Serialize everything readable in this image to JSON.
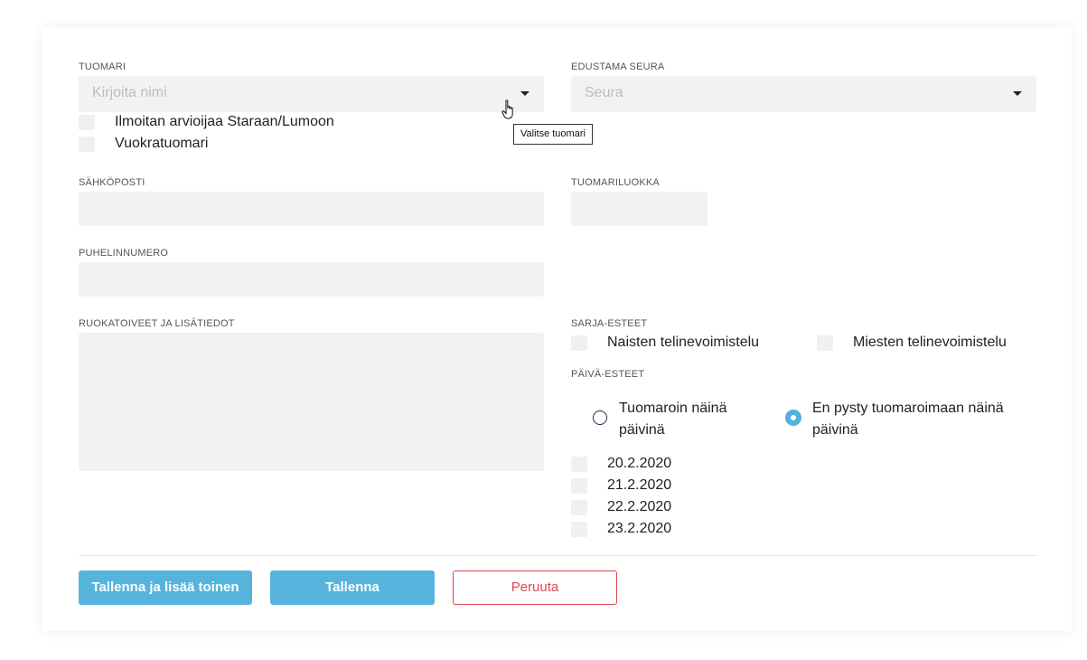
{
  "tuomari": {
    "label": "TUOMARI",
    "placeholder": "Kirjoita nimi",
    "tooltip": "Valitse tuomari",
    "checkboxes": [
      {
        "label": "Ilmoitan arvioijaa Staraan/Lumoon",
        "checked": false
      },
      {
        "label": "Vuokratuomari",
        "checked": false
      }
    ]
  },
  "seura": {
    "label": "EDUSTAMA SEURA",
    "placeholder": "Seura"
  },
  "sahkoposti": {
    "label": "SÄHKÖPOSTI",
    "value": ""
  },
  "tuomariluokka": {
    "label": "TUOMARILUOKKA",
    "value": ""
  },
  "puhelinnumero": {
    "label": "PUHELINNUMERO",
    "value": ""
  },
  "ruokatoiveet": {
    "label": "RUOKATOIVEET JA LISÄTIEDOT",
    "value": ""
  },
  "sarja_esteet": {
    "label": "SARJA-ESTEET",
    "options": [
      {
        "label": "Naisten telinevoimistelu",
        "checked": false
      },
      {
        "label": "Miesten telinevoimistelu",
        "checked": false
      }
    ]
  },
  "paiva_esteet": {
    "label": "PÄIVÄ-ESTEET",
    "radio_can": {
      "line1": "Tuomaroin näinä",
      "line2": "päivinä",
      "checked": false
    },
    "radio_cannot": {
      "line1": "En pysty tuomaroimaan näinä",
      "line2": "päivinä",
      "checked": true
    },
    "dates": [
      "20.2.2020",
      "21.2.2020",
      "22.2.2020",
      "23.2.2020"
    ]
  },
  "buttons": {
    "save_and_add": "Tallenna ja lisää toinen",
    "save": "Tallenna",
    "cancel": "Peruuta"
  },
  "colors": {
    "primary": "#56b4dc",
    "danger": "#e0454f",
    "field_bg": "#f2f2f2"
  }
}
